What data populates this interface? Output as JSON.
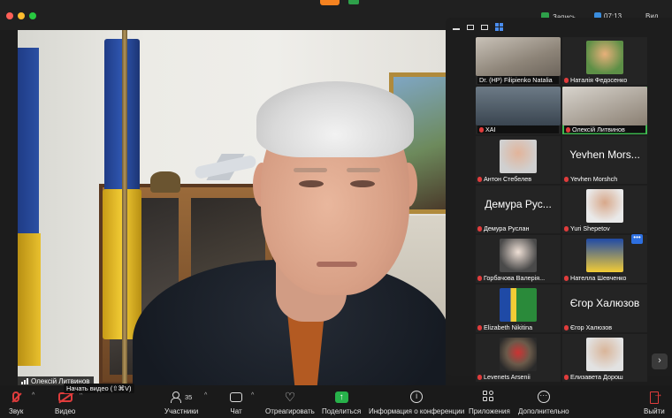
{
  "titlebar": {
    "recording_label": "Запись",
    "time": "07:13",
    "view_label": "Вид"
  },
  "main_video": {
    "speaker_name": "Олексій Литвинов"
  },
  "tooltip": "Начать видео (⇧⌘V)",
  "gallery": {
    "tiles": [
      {
        "name": "Dr. (HP) Filipienko Natalia",
        "type": "video",
        "muted": false
      },
      {
        "name": "Наталія Федосенко",
        "type": "photo",
        "muted": true
      },
      {
        "name": "ХАІ",
        "type": "video",
        "muted": true
      },
      {
        "name": "Олексій Литвинов",
        "type": "video",
        "muted": true,
        "active": true
      },
      {
        "name": "Антон Стебелев",
        "type": "photo",
        "muted": true
      },
      {
        "name": "Yevhen Morshch",
        "big_name": "Yevhen Mors...",
        "type": "text",
        "muted": true
      },
      {
        "name": "Демура Руслан",
        "big_name": "Демура Рус...",
        "type": "text",
        "muted": true
      },
      {
        "name": "Yuri Shepetov",
        "type": "photo",
        "muted": true
      },
      {
        "name": "Горбачова Валерія...",
        "type": "photo",
        "muted": true
      },
      {
        "name": "Нателла Шевченко",
        "type": "photo",
        "muted": true
      },
      {
        "name": "Elizabeth Nikitina",
        "type": "photo",
        "muted": true
      },
      {
        "name": "Єгор Халюзов",
        "big_name": "Єгор Халюзов",
        "type": "text",
        "muted": true
      },
      {
        "name": "Levenets Arsenii",
        "type": "photo",
        "muted": true
      },
      {
        "name": "Елизавета Дорош",
        "type": "photo",
        "muted": true
      }
    ]
  },
  "toolbar": {
    "audio": "Звук",
    "video": "Видео",
    "participants": "Участники",
    "participants_count": "35",
    "chat": "Чат",
    "react": "Отреагировать",
    "share": "Поделиться",
    "info": "Информация о конференции",
    "apps": "Приложения",
    "more": "Дополнительно",
    "leave": "Выйти"
  },
  "colors": {
    "accent_green": "#3fb950",
    "mute_red": "#e03c3c",
    "share_green": "#27b24a",
    "grid_blue": "#4a8df0"
  }
}
